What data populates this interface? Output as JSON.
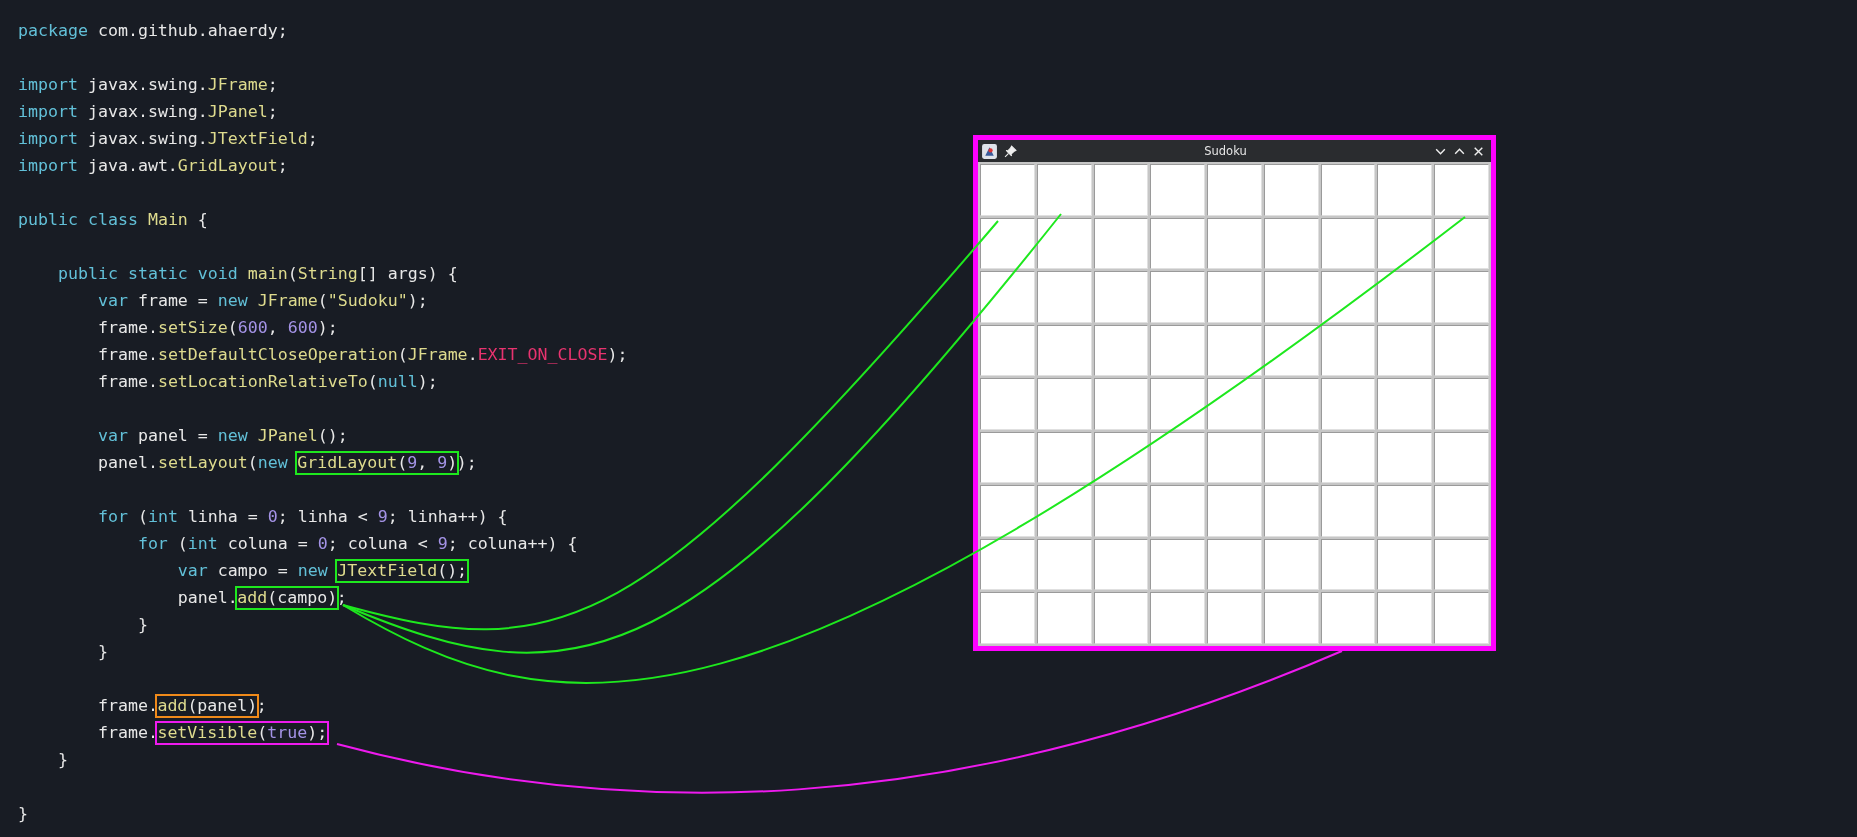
{
  "code_lines": [
    {
      "kind": "code",
      "segments": [
        {
          "tokens": [
            {
              "t": "package",
              "kind": "keyword"
            },
            {
              "t": " com.github.ahaerdy;",
              "kind": "plain"
            }
          ]
        }
      ]
    },
    {
      "kind": "blank"
    },
    {
      "kind": "code",
      "segments": [
        {
          "tokens": [
            {
              "t": "import",
              "kind": "keyword"
            },
            {
              "t": " javax.swing.",
              "kind": "plain"
            },
            {
              "t": "JFrame",
              "kind": "name"
            },
            {
              "t": ";",
              "kind": "plain"
            }
          ]
        }
      ]
    },
    {
      "kind": "code",
      "segments": [
        {
          "tokens": [
            {
              "t": "import",
              "kind": "keyword"
            },
            {
              "t": " javax.swing.",
              "kind": "plain"
            },
            {
              "t": "JPanel",
              "kind": "name"
            },
            {
              "t": ";",
              "kind": "plain"
            }
          ]
        }
      ]
    },
    {
      "kind": "code",
      "segments": [
        {
          "tokens": [
            {
              "t": "import",
              "kind": "keyword"
            },
            {
              "t": " javax.swing.",
              "kind": "plain"
            },
            {
              "t": "JTextField",
              "kind": "name"
            },
            {
              "t": ";",
              "kind": "plain"
            }
          ]
        }
      ]
    },
    {
      "kind": "code",
      "segments": [
        {
          "tokens": [
            {
              "t": "import",
              "kind": "keyword"
            },
            {
              "t": " java.awt.",
              "kind": "plain"
            },
            {
              "t": "GridLayout",
              "kind": "name"
            },
            {
              "t": ";",
              "kind": "plain"
            }
          ]
        }
      ]
    },
    {
      "kind": "blank"
    },
    {
      "kind": "code",
      "segments": [
        {
          "tokens": [
            {
              "t": "public",
              "kind": "keyword"
            },
            {
              "t": " class",
              "kind": "keyword"
            },
            {
              "t": " Main",
              "kind": "name"
            },
            {
              "t": " {",
              "kind": "plain"
            }
          ]
        }
      ]
    },
    {
      "kind": "blank"
    },
    {
      "kind": "code",
      "segments": [
        {
          "tokens": [
            {
              "t": "    public",
              "kind": "keyword"
            },
            {
              "t": " static",
              "kind": "keyword"
            },
            {
              "t": " void",
              "kind": "keyword"
            },
            {
              "t": " main",
              "kind": "name"
            },
            {
              "t": "(",
              "kind": "plain"
            },
            {
              "t": "String",
              "kind": "name"
            },
            {
              "t": "[] args) {",
              "kind": "plain"
            }
          ]
        }
      ]
    },
    {
      "kind": "code",
      "segments": [
        {
          "tokens": [
            {
              "t": "        var",
              "kind": "keyword"
            },
            {
              "t": " frame = ",
              "kind": "plain"
            },
            {
              "t": "new",
              "kind": "keyword"
            },
            {
              "t": " JFrame",
              "kind": "name"
            },
            {
              "t": "(",
              "kind": "plain"
            },
            {
              "t": "\"Sudoku\"",
              "kind": "string"
            },
            {
              "t": ");",
              "kind": "plain"
            }
          ]
        }
      ]
    },
    {
      "kind": "code",
      "segments": [
        {
          "tokens": [
            {
              "t": "        frame.",
              "kind": "plain"
            },
            {
              "t": "setSize",
              "kind": "name"
            },
            {
              "t": "(",
              "kind": "plain"
            },
            {
              "t": "600",
              "kind": "number"
            },
            {
              "t": ", ",
              "kind": "plain"
            },
            {
              "t": "600",
              "kind": "number"
            },
            {
              "t": ");",
              "kind": "plain"
            }
          ]
        }
      ]
    },
    {
      "kind": "code",
      "segments": [
        {
          "tokens": [
            {
              "t": "        frame.",
              "kind": "plain"
            },
            {
              "t": "setDefaultCloseOperation",
              "kind": "name"
            },
            {
              "t": "(",
              "kind": "plain"
            },
            {
              "t": "JFrame",
              "kind": "name"
            },
            {
              "t": ".",
              "kind": "plain"
            },
            {
              "t": "EXIT_ON_CLOSE",
              "kind": "constant"
            },
            {
              "t": ");",
              "kind": "plain"
            }
          ]
        }
      ]
    },
    {
      "kind": "code",
      "segments": [
        {
          "tokens": [
            {
              "t": "        frame.",
              "kind": "plain"
            },
            {
              "t": "setLocationRelativeTo",
              "kind": "name"
            },
            {
              "t": "(",
              "kind": "plain"
            },
            {
              "t": "null",
              "kind": "keyword"
            },
            {
              "t": ");",
              "kind": "plain"
            }
          ]
        }
      ]
    },
    {
      "kind": "blank"
    },
    {
      "kind": "code",
      "segments": [
        {
          "tokens": [
            {
              "t": "        var",
              "kind": "keyword"
            },
            {
              "t": " panel = ",
              "kind": "plain"
            },
            {
              "t": "new",
              "kind": "keyword"
            },
            {
              "t": " JPanel",
              "kind": "name"
            },
            {
              "t": "();",
              "kind": "plain"
            }
          ]
        }
      ]
    },
    {
      "kind": "code",
      "segments": [
        {
          "tokens": [
            {
              "t": "        panel.",
              "kind": "plain"
            },
            {
              "t": "setLayout",
              "kind": "name"
            },
            {
              "t": "(",
              "kind": "plain"
            },
            {
              "t": "new ",
              "kind": "keyword"
            }
          ]
        },
        {
          "color": "#1ee81e",
          "tokens": [
            {
              "t": "GridLayout",
              "kind": "name"
            },
            {
              "t": "(",
              "kind": "plain"
            },
            {
              "t": "9",
              "kind": "number"
            },
            {
              "t": ", ",
              "kind": "plain"
            },
            {
              "t": "9",
              "kind": "number"
            },
            {
              "t": ")",
              "kind": "plain"
            }
          ]
        },
        {
          "tokens": [
            {
              "t": ");",
              "kind": "plain"
            }
          ]
        }
      ]
    },
    {
      "kind": "blank"
    },
    {
      "kind": "code",
      "segments": [
        {
          "tokens": [
            {
              "t": "        for",
              "kind": "keyword"
            },
            {
              "t": " (",
              "kind": "plain"
            },
            {
              "t": "int",
              "kind": "keyword"
            },
            {
              "t": " linha = ",
              "kind": "plain"
            },
            {
              "t": "0",
              "kind": "number"
            },
            {
              "t": "; linha < ",
              "kind": "plain"
            },
            {
              "t": "9",
              "kind": "number"
            },
            {
              "t": "; linha++) {",
              "kind": "plain"
            }
          ]
        }
      ]
    },
    {
      "kind": "code",
      "segments": [
        {
          "tokens": [
            {
              "t": "            for",
              "kind": "keyword"
            },
            {
              "t": " (",
              "kind": "plain"
            },
            {
              "t": "int",
              "kind": "keyword"
            },
            {
              "t": " coluna = ",
              "kind": "plain"
            },
            {
              "t": "0",
              "kind": "number"
            },
            {
              "t": "; coluna < ",
              "kind": "plain"
            },
            {
              "t": "9",
              "kind": "number"
            },
            {
              "t": "; coluna++) {",
              "kind": "plain"
            }
          ]
        }
      ]
    },
    {
      "kind": "code",
      "segments": [
        {
          "tokens": [
            {
              "t": "                var",
              "kind": "keyword"
            },
            {
              "t": " campo = ",
              "kind": "plain"
            },
            {
              "t": "new ",
              "kind": "keyword"
            }
          ]
        },
        {
          "color": "#1ee81e",
          "tokens": [
            {
              "t": "JTextField",
              "kind": "name"
            },
            {
              "t": "();",
              "kind": "plain"
            }
          ]
        }
      ]
    },
    {
      "kind": "code",
      "segments": [
        {
          "tokens": [
            {
              "t": "                panel.",
              "kind": "plain"
            }
          ]
        },
        {
          "color": "#1ee81e",
          "tokens": [
            {
              "t": "add",
              "kind": "name"
            },
            {
              "t": "(campo)",
              "kind": "plain"
            }
          ]
        },
        {
          "tokens": [
            {
              "t": ";",
              "kind": "plain"
            }
          ]
        }
      ]
    },
    {
      "kind": "code",
      "segments": [
        {
          "tokens": [
            {
              "t": "            }",
              "kind": "plain"
            }
          ]
        }
      ]
    },
    {
      "kind": "code",
      "segments": [
        {
          "tokens": [
            {
              "t": "        }",
              "kind": "plain"
            }
          ]
        }
      ]
    },
    {
      "kind": "blank"
    },
    {
      "kind": "code",
      "segments": [
        {
          "tokens": [
            {
              "t": "        frame.",
              "kind": "plain"
            }
          ]
        },
        {
          "color": "#f08a1a",
          "tokens": [
            {
              "t": "add",
              "kind": "name"
            },
            {
              "t": "(panel)",
              "kind": "plain"
            }
          ]
        },
        {
          "tokens": [
            {
              "t": ";",
              "kind": "plain"
            }
          ]
        }
      ]
    },
    {
      "kind": "code",
      "segments": [
        {
          "tokens": [
            {
              "t": "        frame.",
              "kind": "plain"
            }
          ]
        },
        {
          "color": "#ee1aee",
          "tokens": [
            {
              "t": "setVisible",
              "kind": "name"
            },
            {
              "t": "(",
              "kind": "plain"
            },
            {
              "t": "true",
              "kind": "number"
            },
            {
              "t": ");",
              "kind": "plain"
            }
          ]
        }
      ]
    },
    {
      "kind": "code",
      "segments": [
        {
          "tokens": [
            {
              "t": "    }",
              "kind": "plain"
            }
          ]
        }
      ]
    },
    {
      "kind": "blank"
    },
    {
      "kind": "code",
      "segments": [
        {
          "tokens": [
            {
              "t": "}",
              "kind": "plain"
            }
          ]
        }
      ]
    }
  ],
  "window": {
    "title": "Sudoku",
    "color": "#ff00ff"
  },
  "connectors": [
    {
      "color": "#1ee81e"
    },
    {
      "color": "#1ee81e"
    },
    {
      "color": "#1ee81e"
    },
    {
      "color": "#ee1aee"
    }
  ]
}
